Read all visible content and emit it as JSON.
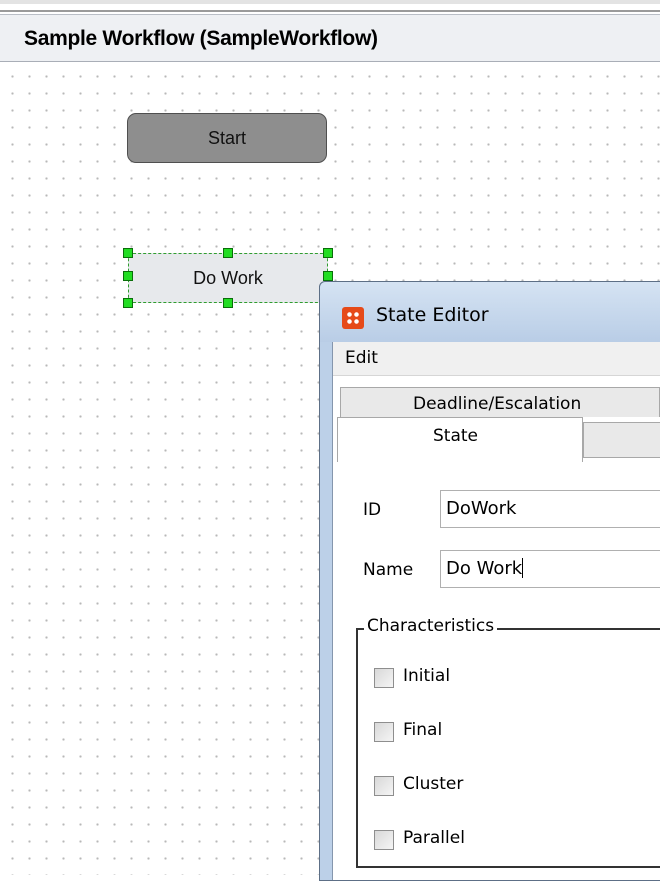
{
  "window": {
    "title": "Sample Workflow (SampleWorkflow)"
  },
  "diagram": {
    "nodes": {
      "start": "Start",
      "do_work": "Do Work"
    }
  },
  "dialog": {
    "title": "State Editor",
    "menu": {
      "edit": "Edit"
    },
    "tabs": {
      "deadline": "Deadline/Escalation",
      "state": "State"
    },
    "form": {
      "id_label": "ID",
      "id_value": "DoWork",
      "name_label": "Name",
      "name_value": "Do Work"
    },
    "characteristics": {
      "title": "Characteristics",
      "items": [
        "Initial",
        "Final",
        "Cluster",
        "Parallel"
      ]
    }
  },
  "colors": {
    "selection_handle": "#22dd22",
    "start_node_fill": "#8e8e8e",
    "dialog_frame": "#bcd0e8",
    "app_icon": "#e64a19"
  },
  "icons": {
    "dialog_icon": "app-logo-icon"
  }
}
